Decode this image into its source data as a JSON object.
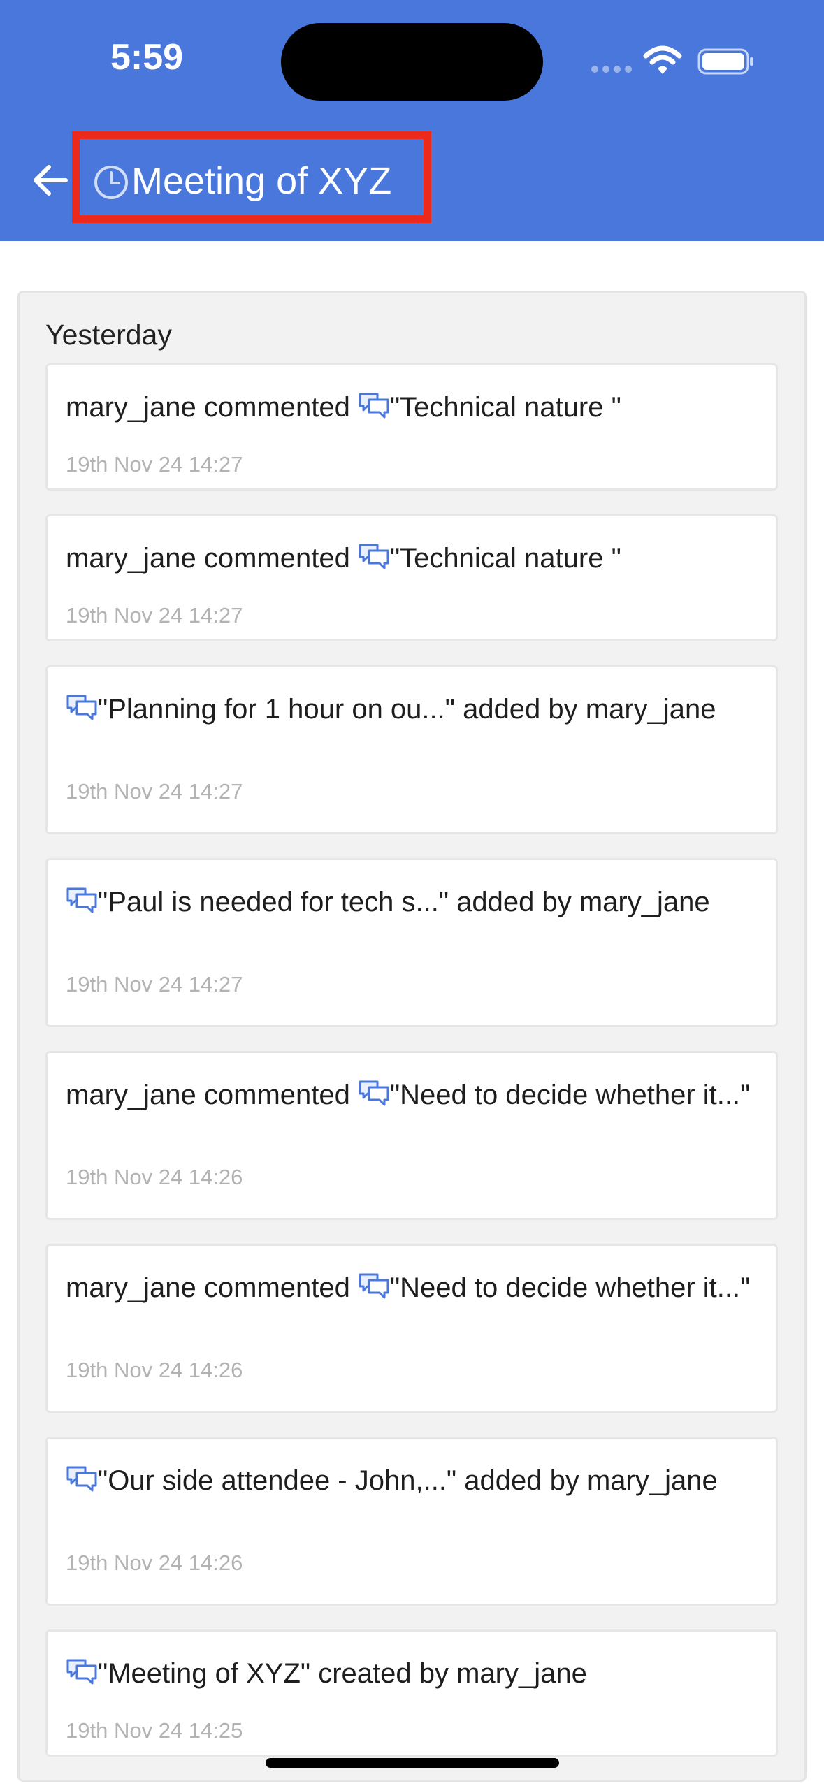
{
  "status_bar": {
    "time": "5:59"
  },
  "header": {
    "title": "Meeting of XYZ"
  },
  "colors": {
    "header_bg": "#4a77dc",
    "highlight_box": "#ec2a1c",
    "timestamp": "#b3b3b3"
  },
  "activity": {
    "group_label": "Yesterday",
    "items": [
      {
        "pre": "mary_jane commented ",
        "post": "\"Technical nature \"",
        "time": "19th Nov 24 14:27"
      },
      {
        "pre": "mary_jane commented ",
        "post": "\"Technical nature \"",
        "time": "19th Nov 24 14:27"
      },
      {
        "pre": "",
        "post": "\"Planning for 1 hour on ou...\" added by mary_jane",
        "time": "19th Nov 24 14:27"
      },
      {
        "pre": "",
        "post": "\"Paul is needed for tech s...\" added by mary_jane",
        "time": "19th Nov 24 14:27"
      },
      {
        "pre": "mary_jane commented ",
        "post": "\"Need to decide whether it...\"",
        "time": "19th Nov 24 14:26"
      },
      {
        "pre": "mary_jane commented ",
        "post": "\"Need to decide whether it...\"",
        "time": "19th Nov 24 14:26"
      },
      {
        "pre": "",
        "post": "\"Our side attendee - John,...\" added by mary_jane",
        "time": "19th Nov 24 14:26"
      },
      {
        "pre": "",
        "post": "\"Meeting of XYZ\" created by mary_jane",
        "time": "19th Nov 24 14:25"
      }
    ]
  }
}
